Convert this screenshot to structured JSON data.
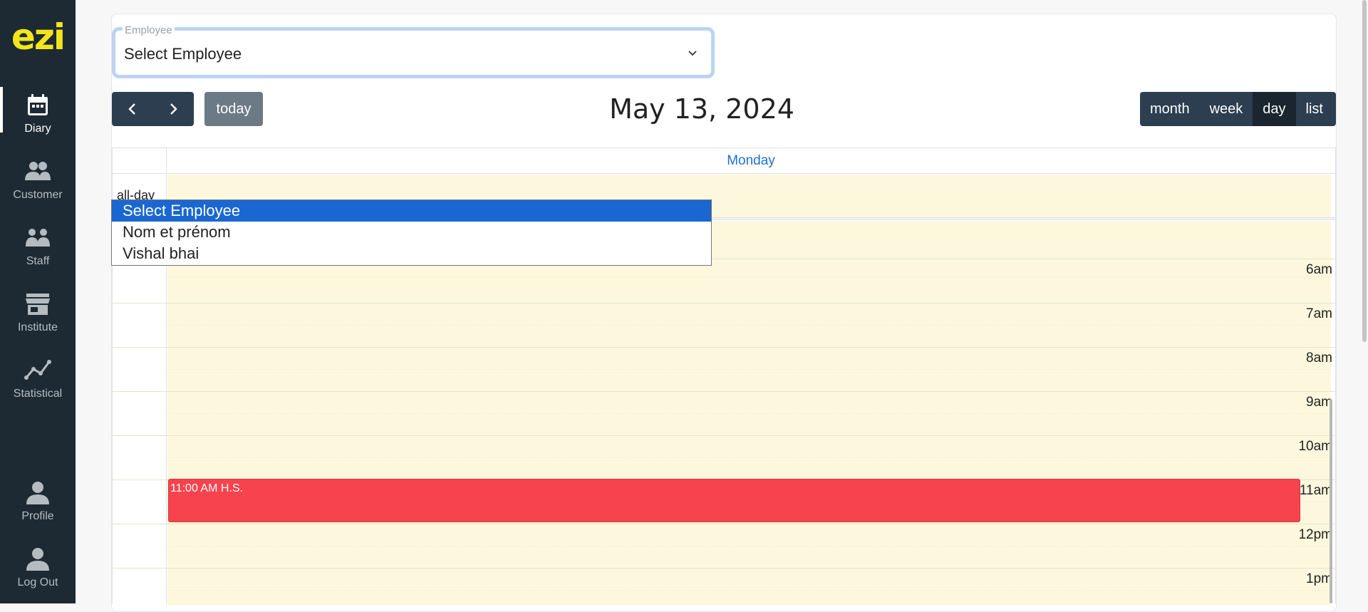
{
  "app": {
    "logo": "ezi",
    "accent_color": "#f3e51c",
    "sidebar_color": "#1d2a33"
  },
  "sidebar": {
    "items": [
      {
        "label": "Diary",
        "icon": "calendar-icon",
        "active": true
      },
      {
        "label": "Customer",
        "icon": "users-icon",
        "active": false
      },
      {
        "label": "Staff",
        "icon": "staff-icon",
        "active": false
      },
      {
        "label": "Institute",
        "icon": "store-icon",
        "active": false
      },
      {
        "label": "Statistical",
        "icon": "chart-line-icon",
        "active": false
      }
    ],
    "bottom_items": [
      {
        "label": "Profile",
        "icon": "user-icon"
      },
      {
        "label": "Log Out",
        "icon": "user-icon"
      }
    ]
  },
  "employee_select": {
    "legend": "Employee",
    "value": "Select Employee",
    "options": [
      "Select Employee",
      "Nom et prénom",
      "Vishal bhai"
    ],
    "selected_index": 0
  },
  "toolbar": {
    "prev_icon": "chevron-left-icon",
    "next_icon": "chevron-right-icon",
    "today_label": "today",
    "title": "May 13, 2024",
    "views": [
      "month",
      "week",
      "day",
      "list"
    ],
    "active_view": "day"
  },
  "calendar": {
    "day_header": "Monday",
    "allday_label": "all-day",
    "hours": [
      "6am",
      "7am",
      "8am",
      "9am",
      "10am",
      "11am",
      "12pm",
      "1pm"
    ],
    "event": {
      "text": "11:00 AM H.S.",
      "color": "#f7434d"
    },
    "slot_color": "#fdf8dd",
    "header_color": "#1f6fd0"
  }
}
